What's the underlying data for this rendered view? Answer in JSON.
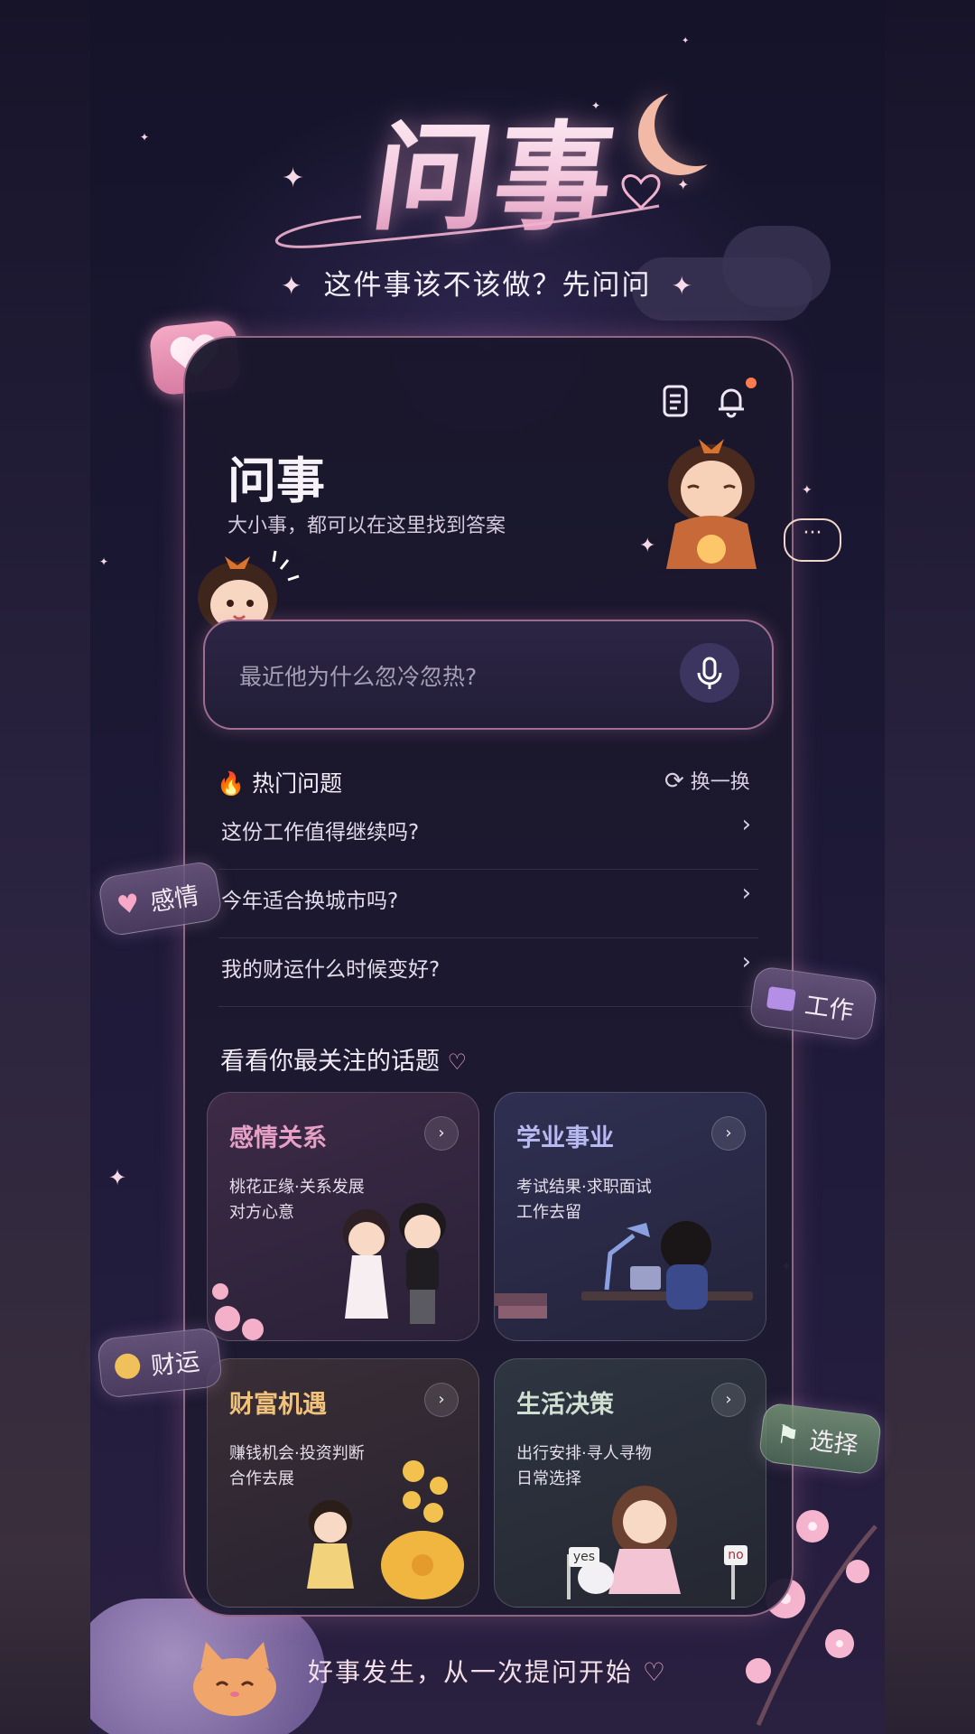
{
  "app": {
    "brand_title": "问事",
    "slogan": "这件事该不该做？先问问",
    "footer": "好事发生，从一次提问开始"
  },
  "card": {
    "title": "问事",
    "subtitle": "大小事，都可以在这里找到答案"
  },
  "search": {
    "placeholder": "最近他为什么忽冷忽热?"
  },
  "hot": {
    "title": "热门问题",
    "refresh_label": "换一换",
    "questions": [
      "这份工作值得继续吗?",
      "今年适合换城市吗?",
      "我的财运什么时候变好?"
    ]
  },
  "topics": {
    "title": "看看你最关注的话题",
    "items": [
      {
        "title": "感情关系",
        "line1": "桃花正缘·关系发展",
        "line2": "对方心意",
        "color": "#e6a0c6"
      },
      {
        "title": "学业事业",
        "line1": "考试结果·求职面试",
        "line2": "工作去留",
        "color": "#b7b9f0"
      },
      {
        "title": "财富机遇",
        "line1": "赚钱机会·投资判断",
        "line2": "合作去展",
        "color": "#f0c27a"
      },
      {
        "title": "生活决策",
        "line1": "出行安排·寻人寻物",
        "line2": "日常选择",
        "color": "#cfe0d2"
      }
    ]
  },
  "tags": {
    "love": "感情",
    "work": "工作",
    "wealth": "财运",
    "choice": "选择"
  },
  "signs": {
    "yes": "yes",
    "no": "no"
  },
  "colors": {
    "accent_pink": "#f0a8c8",
    "notification_dot": "#ff7a4f",
    "background": "#1b1834"
  }
}
